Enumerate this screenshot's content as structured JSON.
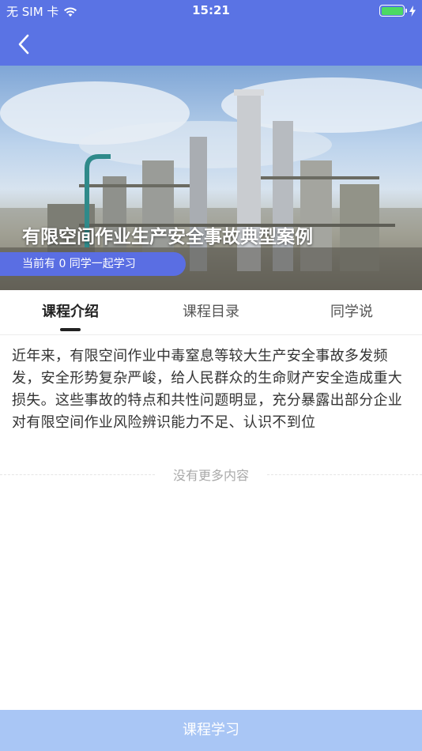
{
  "status_bar": {
    "carrier": "无 SIM 卡",
    "time": "15:21",
    "battery_level": 1.0
  },
  "nav": {
    "back_icon": "chevron-left-icon"
  },
  "hero": {
    "title": "有限空间作业生产安全事故典型案例",
    "learners_text": "当前有 0 同学一起学习"
  },
  "tabs": [
    {
      "label": "课程介绍",
      "active": true
    },
    {
      "label": "课程目录",
      "active": false
    },
    {
      "label": "同学说",
      "active": false
    }
  ],
  "intro": {
    "text": "近年来，有限空间作业中毒窒息等较大生产安全事故多发频发，安全形势复杂严峻，给人民群众的生命财产安全造成重大损失。这些事故的特点和共性问题明显，充分暴露出部分企业对有限空间作业风险辨识能力不足、认识不到位"
  },
  "no_more_text": "没有更多内容",
  "bottom_button": {
    "label": "课程学习"
  },
  "colors": {
    "primary": "#5a73e4",
    "pill": "#5a6ee3",
    "bottom_button": "#a9c6f5",
    "battery": "#4cd964"
  }
}
